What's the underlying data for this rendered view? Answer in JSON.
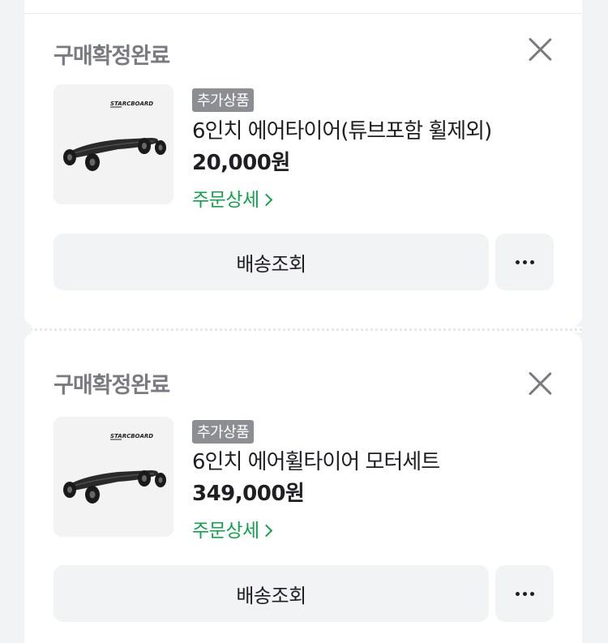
{
  "orders": [
    {
      "status": "구매확정완료",
      "badge": "추가상품",
      "product_name": "6인치 에어타이어(튜브포함 휠제외)",
      "price": "20,000원",
      "detail_link": "주문상세",
      "track_button": "배송조회",
      "thumbnail_brand": "STARCBOARD"
    },
    {
      "status": "구매확정완료",
      "badge": "추가상품",
      "product_name": "6인치 에어휠타이어 모터세트",
      "price": "349,000원",
      "detail_link": "주문상세",
      "track_button": "배송조회",
      "thumbnail_brand": "STARCBOARD"
    }
  ],
  "icons": {
    "close": "close-icon",
    "more": "more-horizontal-icon",
    "chevron": "chevron-right-icon"
  },
  "colors": {
    "status_text": "#7a7b80",
    "link_green": "#0fa34a",
    "badge_bg": "#8d8e93",
    "button_bg": "#f2f3f5"
  }
}
